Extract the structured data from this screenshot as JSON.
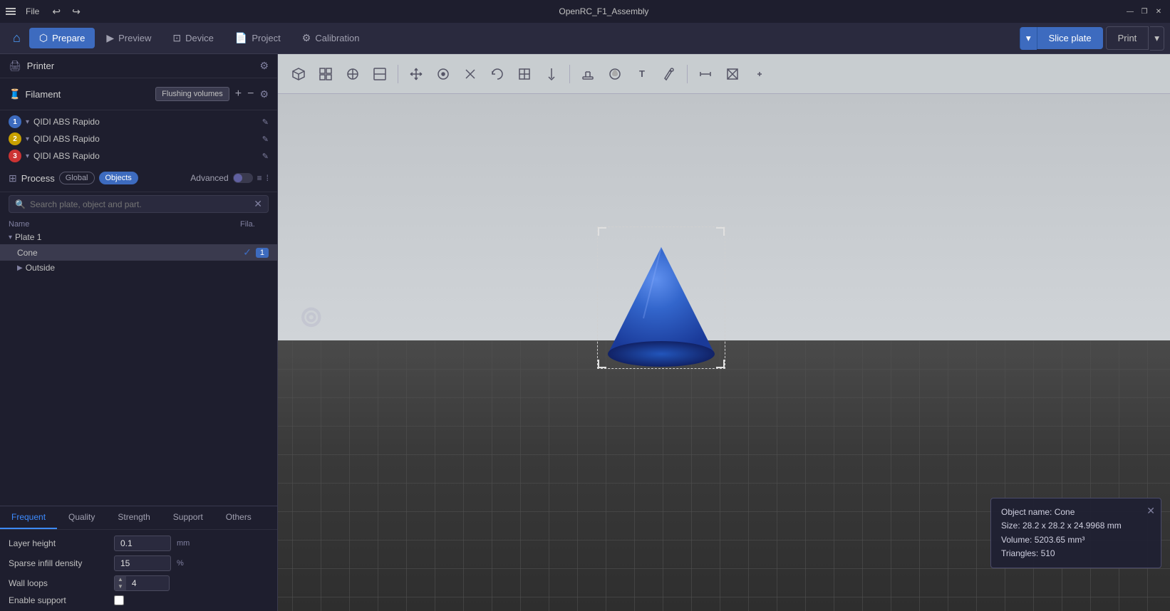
{
  "titleBar": {
    "title": "OpenRC_F1_Assembly",
    "menuLabel": "File",
    "winMin": "—",
    "winRestore": "❐",
    "winClose": "✕"
  },
  "navBar": {
    "home": "⌂",
    "tabs": [
      {
        "label": "Prepare",
        "active": true
      },
      {
        "label": "Preview",
        "active": false
      },
      {
        "label": "Device",
        "active": false
      },
      {
        "label": "Project",
        "active": false
      },
      {
        "label": "Calibration",
        "active": false
      }
    ],
    "sliceBtn": "Slice plate",
    "printBtn": "Print"
  },
  "leftPanel": {
    "printer": {
      "label": "Printer",
      "settingsTitle": "Printer settings"
    },
    "filament": {
      "label": "Filament",
      "flushingBtn": "Flushing volumes",
      "entries": [
        {
          "num": "1",
          "color": "#3d6bbf",
          "name": "QIDI ABS Rapido"
        },
        {
          "num": "2",
          "color": "#c8a000",
          "name": "QIDI ABS Rapido"
        },
        {
          "num": "3",
          "color": "#cc3333",
          "name": "QIDI ABS Rapido"
        }
      ]
    },
    "process": {
      "label": "Process",
      "globalBtn": "Global",
      "objectsBtn": "Objects",
      "advancedLabel": "Advanced",
      "searchPlaceholder": "Search plate, object and part."
    },
    "tree": {
      "colName": "Name",
      "colFila": "Fila.",
      "plate1": "Plate 1",
      "cone": "Cone",
      "outside": "Outside"
    },
    "tabs": [
      "Frequent",
      "Quality",
      "Strength",
      "Support",
      "Others"
    ],
    "activeTab": "Frequent",
    "settings": {
      "layerHeight": {
        "label": "Layer height",
        "value": "0.1",
        "unit": "mm"
      },
      "sparseInfillDensity": {
        "label": "Sparse infill density",
        "value": "15",
        "unit": "%"
      },
      "wallLoops": {
        "label": "Wall loops",
        "value": "4"
      },
      "enableSupport": {
        "label": "Enable support"
      }
    }
  },
  "viewport": {
    "infoCard": {
      "objectName": "Object name: Cone",
      "size": "Size: 28.2 x 28.2 x 24.9968 mm",
      "volume": "Volume: 5203.65 mm³",
      "triangles": "Triangles: 510"
    }
  },
  "toolbar": {
    "icons": [
      "⬜",
      "⊞",
      "⊡",
      "⊟",
      "⊙",
      "⬡",
      "≡",
      "◻",
      "⦿",
      "⊗",
      "⊞",
      "⊘",
      "□",
      "⊟",
      "⬜",
      "⬡",
      "⬢",
      "□",
      "⊕",
      "Aa",
      "⊕",
      "≋",
      "⊡",
      "⊟"
    ]
  }
}
